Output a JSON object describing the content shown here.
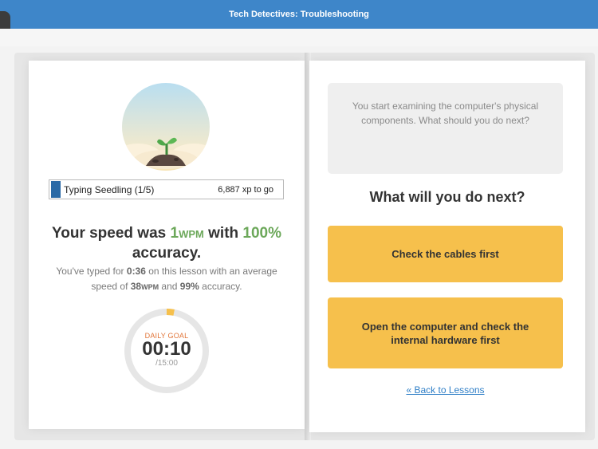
{
  "header": {
    "title": "Tech Detectives: Troubleshooting"
  },
  "avatar": {
    "icon": "seedling-icon"
  },
  "level": {
    "name": "Typing Seedling (1/5)",
    "xp_to_go": "6,887 xp to go"
  },
  "results": {
    "speed_prefix": "Your speed was ",
    "speed_value": "1",
    "speed_unit": "WPM",
    "speed_mid": " with ",
    "accuracy_value": "100%",
    "accuracy_suffix": "accuracy.",
    "detail_1": "You've typed for ",
    "typed_time": "0:36",
    "detail_2": " on this lesson with an average speed of ",
    "avg_speed": "38",
    "avg_unit": "WPM",
    "detail_3": " and ",
    "avg_accuracy": "99%",
    "detail_4": " accuracy."
  },
  "daily_goal": {
    "label": "DAILY GOAL",
    "time": "00:10",
    "total": "/15:00",
    "progress_fraction": 0.011
  },
  "story": {
    "prompt": "You start examining the computer's physical components. What should you do next?",
    "question": "What will you do next?",
    "choices": [
      {
        "label": "Check the cables first"
      },
      {
        "label": "Open the computer and check the internal hardware first"
      }
    ],
    "back_link": "« Back to Lessons"
  },
  "colors": {
    "topbar": "#3e86c9",
    "accent_green": "#6ca85a",
    "choice_yellow": "#f6c04c",
    "goal_orange": "#e2763a",
    "link_blue": "#2f7fc7"
  }
}
